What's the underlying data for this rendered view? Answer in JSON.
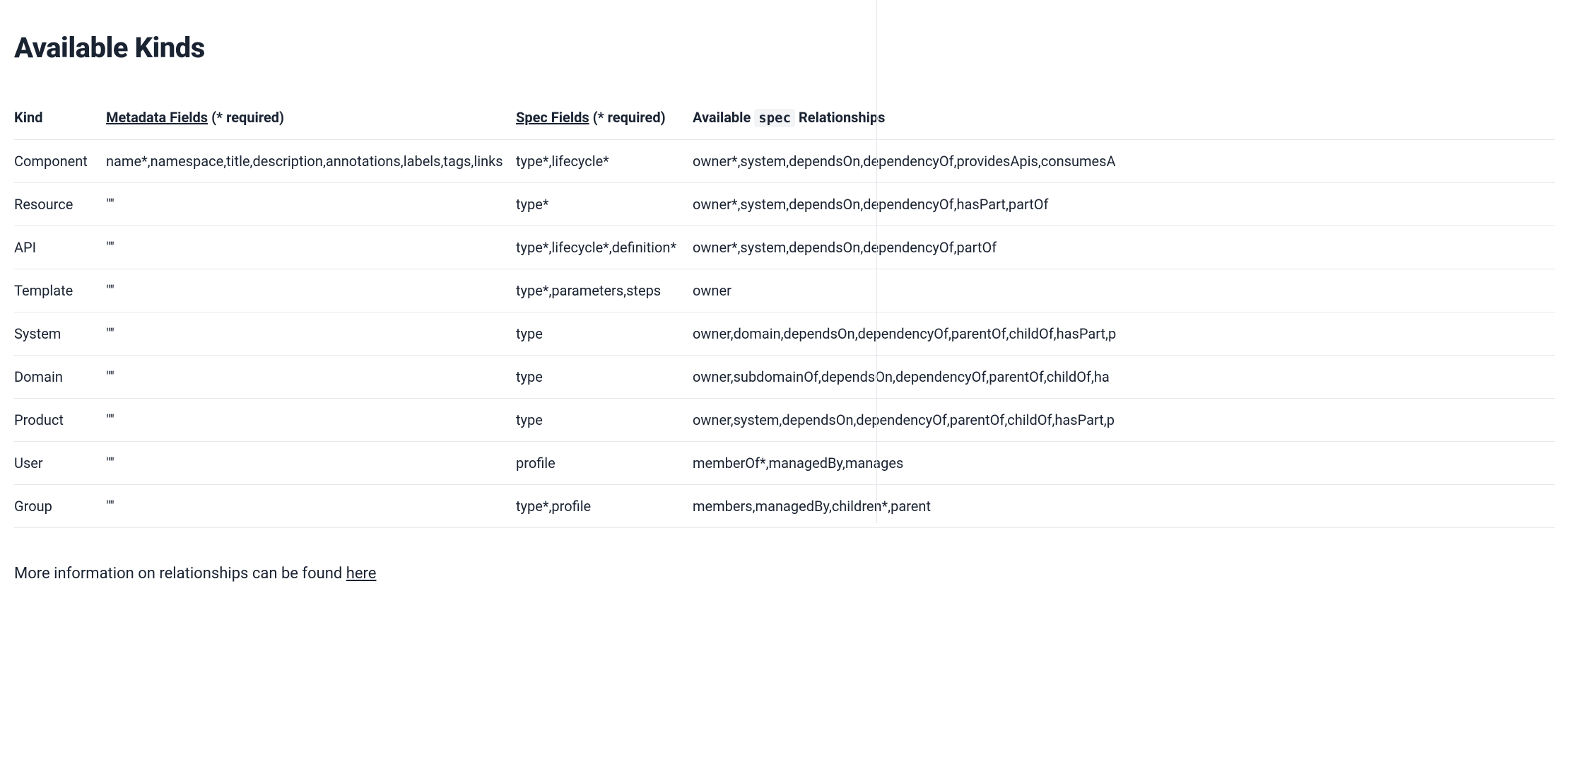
{
  "title": "Available Kinds",
  "headers": {
    "kind": "Kind",
    "metadata_link": "Metadata Fields",
    "metadata_suffix": " (* required)",
    "spec_link": "Spec Fields",
    "spec_suffix": " (* required)",
    "relationships_prefix": "Available ",
    "relationships_code": "spec",
    "relationships_suffix": " Relationships"
  },
  "rows": [
    {
      "kind": "Component",
      "metadata": "name*,namespace,title,description,annotations,labels,tags,links",
      "spec": "type*,lifecycle*",
      "relationships": "owner*,system,dependsOn,dependencyOf,providesApis,consumesA"
    },
    {
      "kind": "Resource",
      "metadata": "\"\"",
      "spec": "type*",
      "relationships": "owner*,system,dependsOn,dependencyOf,hasPart,partOf"
    },
    {
      "kind": "API",
      "metadata": "\"\"",
      "spec": "type*,lifecycle*,definition*",
      "relationships": "owner*,system,dependsOn,dependencyOf,partOf"
    },
    {
      "kind": "Template",
      "metadata": "\"\"",
      "spec": "type*,parameters,steps",
      "relationships": "owner"
    },
    {
      "kind": "System",
      "metadata": "\"\"",
      "spec": "type",
      "relationships": "owner,domain,dependsOn,dependencyOf,parentOf,childOf,hasPart,p"
    },
    {
      "kind": "Domain",
      "metadata": "\"\"",
      "spec": "type",
      "relationships": "owner,subdomainOf,dependsOn,dependencyOf,parentOf,childOf,ha"
    },
    {
      "kind": "Product",
      "metadata": "\"\"",
      "spec": "type",
      "relationships": "owner,system,dependsOn,dependencyOf,parentOf,childOf,hasPart,p"
    },
    {
      "kind": "User",
      "metadata": "\"\"",
      "spec": "profile",
      "relationships": "memberOf*,managedBy,manages"
    },
    {
      "kind": "Group",
      "metadata": "\"\"",
      "spec": "type*,profile",
      "relationships": "members,managedBy,children*,parent"
    }
  ],
  "footer": {
    "prefix": "More information on relationships can be found ",
    "link_text": "here"
  }
}
